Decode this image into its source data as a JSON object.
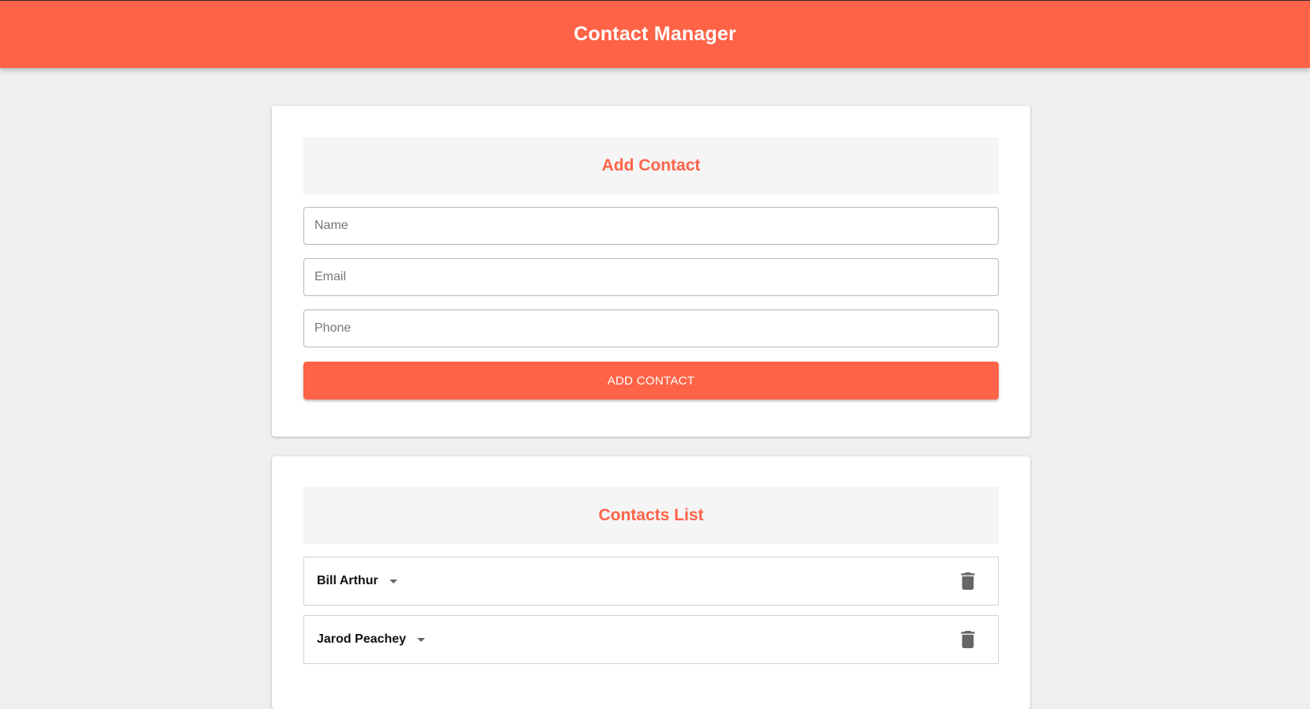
{
  "header": {
    "title": "Contact Manager"
  },
  "add_contact": {
    "title": "Add Contact",
    "fields": {
      "name": {
        "placeholder": "Name",
        "value": ""
      },
      "email": {
        "placeholder": "Email",
        "value": ""
      },
      "phone": {
        "placeholder": "Phone",
        "value": ""
      }
    },
    "button_label": "ADD CONTACT"
  },
  "contacts_list": {
    "title": "Contacts List",
    "items": [
      {
        "name": "Bill Arthur",
        "toggle_icon": "caret-down-icon",
        "delete_icon": "trash-icon"
      },
      {
        "name": "Jarod Peachey",
        "toggle_icon": "caret-down-icon",
        "delete_icon": "trash-icon"
      }
    ]
  },
  "colors": {
    "accent": "#ff6347",
    "background": "#efefef",
    "card": "#ffffff",
    "card_header": "#f5f5f5",
    "icon": "#666666"
  }
}
